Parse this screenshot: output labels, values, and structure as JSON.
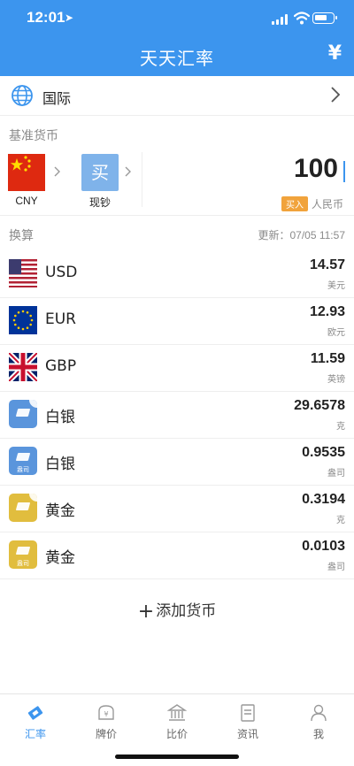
{
  "status": {
    "time": "12:01",
    "location_icon": "location-arrow-icon"
  },
  "header": {
    "title": "天天汇率",
    "currency_symbol": "¥",
    "bg_color": "#3c95ee"
  },
  "region": {
    "label": "国际"
  },
  "base_section": {
    "label": "基准货币"
  },
  "base": {
    "currency_code": "CNY",
    "tile_char": "买",
    "tile_label": "现钞",
    "amount": "100",
    "badge": "买入",
    "currency_name": "人民币"
  },
  "convert": {
    "label": "换算",
    "updated": "更新：07/05 11:57"
  },
  "rows": [
    {
      "name": "USD",
      "value": "14.57",
      "unit": "美元",
      "icon": "us-flag-icon"
    },
    {
      "name": "EUR",
      "value": "12.93",
      "unit": "欧元",
      "icon": "eu-flag-icon"
    },
    {
      "name": "GBP",
      "value": "11.59",
      "unit": "英镑",
      "icon": "uk-flag-icon"
    },
    {
      "name": "白银",
      "value": "29.6578",
      "unit": "克",
      "icon": "silver-bar-icon"
    },
    {
      "name": "白银",
      "value": "0.9535",
      "unit": "盎司",
      "icon": "silver-bar-ounce-icon",
      "icon_sub": "盎司"
    },
    {
      "name": "黄金",
      "value": "0.3194",
      "unit": "克",
      "icon": "gold-bar-icon"
    },
    {
      "name": "黄金",
      "value": "0.0103",
      "unit": "盎司",
      "icon": "gold-bar-ounce-icon",
      "icon_sub": "盎司"
    }
  ],
  "add_button": {
    "label": "添加货币"
  },
  "tabs": [
    {
      "label": "汇率",
      "icon": "exchange-rate-icon",
      "active": true
    },
    {
      "label": "牌价",
      "icon": "price-board-icon",
      "active": false
    },
    {
      "label": "比价",
      "icon": "bank-icon",
      "active": false
    },
    {
      "label": "资讯",
      "icon": "news-icon",
      "active": false
    },
    {
      "label": "我",
      "icon": "person-icon",
      "active": false
    }
  ]
}
